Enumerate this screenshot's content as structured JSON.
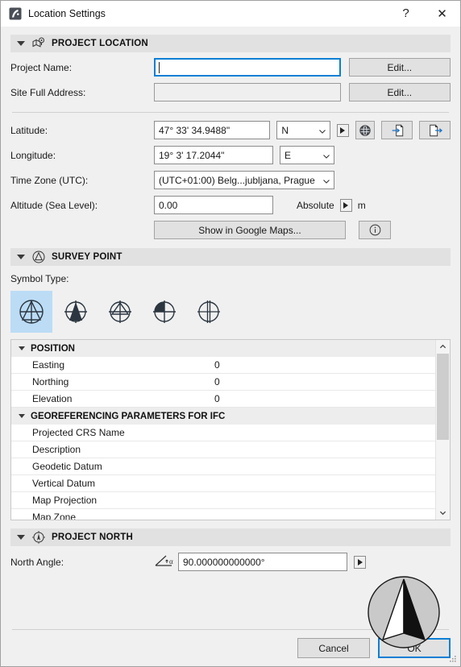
{
  "window": {
    "title": "Location Settings",
    "app_icon": "archicad-logo-icon",
    "help_label": "?",
    "close_label": "✕"
  },
  "project_location": {
    "header": "PROJECT LOCATION",
    "header_icon": "map-pin-icon",
    "project_name": {
      "label": "Project Name:",
      "value": "",
      "button": "Edit..."
    },
    "site_address": {
      "label": "Site Full Address:",
      "value": "",
      "button": "Edit..."
    },
    "latitude": {
      "label": "Latitude:",
      "value": "47° 33' 34.9488\"",
      "hemisphere": "N"
    },
    "longitude": {
      "label": "Longitude:",
      "value": "19° 3' 17.2044\"",
      "hemisphere": "E"
    },
    "time_zone": {
      "label": "Time Zone (UTC):",
      "value": "(UTC+01:00) Belg...jubljana, Prague"
    },
    "altitude": {
      "label": "Altitude (Sea Level):",
      "value": "0.00",
      "mode": "Absolute",
      "unit": "m"
    },
    "google_maps_button": "Show in Google Maps...",
    "info_button_icon": "info-circle-icon",
    "globe_button_icon": "globe-icon",
    "import_button_icon": "import-file-icon",
    "export_button_icon": "export-file-icon",
    "expand_arrow_icon": "arrow-right-icon"
  },
  "survey_point": {
    "header": "SURVEY POINT",
    "header_icon": "survey-point-icon",
    "symbol_type_label": "Symbol Type:",
    "symbols": [
      {
        "name": "symbol-triangle-in-circle",
        "selected": true
      },
      {
        "name": "symbol-filled-triangle",
        "selected": false
      },
      {
        "name": "symbol-open-triangle",
        "selected": false
      },
      {
        "name": "symbol-filled-quadrant",
        "selected": false
      },
      {
        "name": "symbol-crosshair-double-line",
        "selected": false
      }
    ]
  },
  "parameters_list": {
    "groups": [
      {
        "title": "POSITION",
        "rows": [
          {
            "name": "Easting",
            "value": "0"
          },
          {
            "name": "Northing",
            "value": "0"
          },
          {
            "name": "Elevation",
            "value": "0"
          }
        ]
      },
      {
        "title": "GEOREFERENCING PARAMETERS FOR IFC",
        "rows": [
          {
            "name": "Projected CRS Name",
            "value": ""
          },
          {
            "name": "Description",
            "value": ""
          },
          {
            "name": "Geodetic Datum",
            "value": ""
          },
          {
            "name": "Vertical Datum",
            "value": ""
          },
          {
            "name": "Map Projection",
            "value": ""
          },
          {
            "name": "Map Zone",
            "value": ""
          }
        ]
      }
    ],
    "scroll_up_icon": "chevron-up-icon",
    "scroll_down_icon": "chevron-down-icon"
  },
  "project_north": {
    "header": "PROJECT NORTH",
    "header_icon": "compass-icon",
    "north_angle": {
      "label": "North Angle:",
      "icon": "angle-alpha-icon",
      "value": "90.000000000000°"
    },
    "compass_preview_icon": "north-arrow-compass-icon"
  },
  "footer": {
    "cancel": "Cancel",
    "ok": "OK"
  },
  "colors": {
    "accent": "#0a7fd4",
    "selection": "#bcdcf5",
    "dialog_bg": "#f0f0f0",
    "section_bg": "#e1e1e1"
  }
}
